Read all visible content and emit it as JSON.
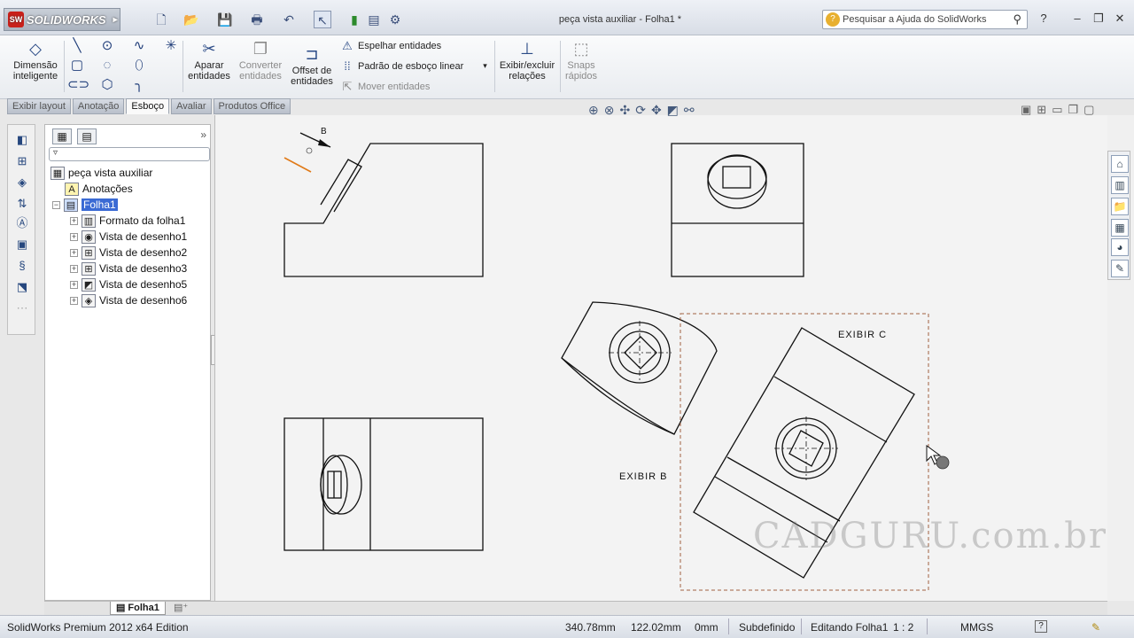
{
  "titlebar": {
    "app_name": "SOLIDWORKS",
    "app_badge": "SW",
    "document_title": "peça vista auxiliar - Folha1 *",
    "help_search_placeholder": "Pesquisar a Ajuda do SolidWorks",
    "quick_access_icons": [
      "new-icon",
      "open-icon",
      "save-icon",
      "print-icon",
      "undo-icon",
      "select-icon",
      "rebuild-icon",
      "file-properties-icon",
      "options-icon"
    ]
  },
  "command_manager": {
    "smart_dimension": "Dimensão inteligente",
    "trim_entities": "Aparar entidades",
    "convert_entities": "Converter entidades",
    "offset_entities": "Offset de entidades",
    "mirror_entities": "Espelhar entidades",
    "linear_pattern": "Padrão de esboço linear",
    "move_entities": "Mover entidades",
    "display_relations": "Exibir/excluir relações",
    "quick_snaps": "Snaps rápidos",
    "sketch_tools": [
      "line-icon",
      "circle-icon",
      "spline-icon",
      "point-icon",
      "rectangle-icon",
      "arc-icon",
      "ellipse-icon",
      "slot-icon",
      "polygon-icon",
      "fillet-icon"
    ]
  },
  "tabs": [
    "Exibir layout",
    "Anotação",
    "Esboço",
    "Avaliar",
    "Produtos Office"
  ],
  "active_tab": "Esboço",
  "feature_manager": {
    "root": "peça vista auxiliar",
    "items": [
      {
        "label": "Anotações",
        "icon": "annotations-icon"
      },
      {
        "label": "Folha1",
        "icon": "sheet-icon",
        "selected": true
      },
      {
        "label": "Formato da folha1",
        "icon": "sheet-format-icon"
      },
      {
        "label": "Vista de desenho1",
        "icon": "drawing-view-icon"
      },
      {
        "label": "Vista de desenho2",
        "icon": "drawing-view-icon"
      },
      {
        "label": "Vista de desenho3",
        "icon": "drawing-view-icon"
      },
      {
        "label": "Vista de desenho5",
        "icon": "auxiliary-view-icon"
      },
      {
        "label": "Vista de desenho6",
        "icon": "auxiliary-view-icon"
      }
    ]
  },
  "drawing": {
    "label_b": "B",
    "label_exibir_c": "EXIBIR C",
    "label_exibir_b": "EXIBIR B"
  },
  "watermark": "CADGURU.com.br",
  "sheet_tabs": {
    "active": "Folha1"
  },
  "statusbar": {
    "edition": "SolidWorks Premium 2012 x64 Edition",
    "x_coord": "340.78mm",
    "y_coord": "122.02mm",
    "z_coord": "0mm",
    "sketch_state": "Subdefinido",
    "editing": "Editando Folha1",
    "scale": "1 : 2",
    "units": "MMGS",
    "help_icon": "?"
  }
}
